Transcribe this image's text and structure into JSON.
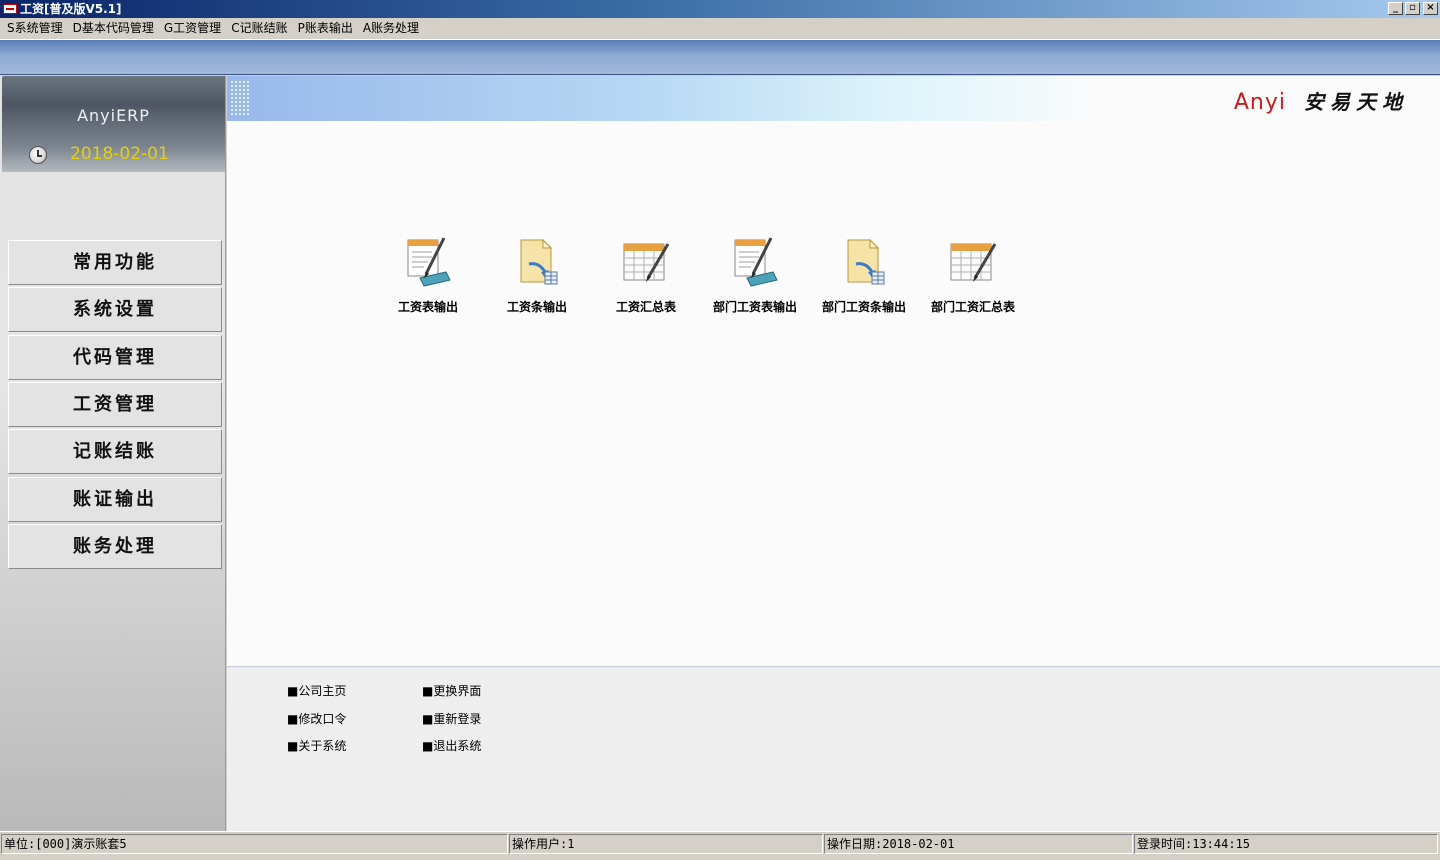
{
  "window": {
    "title": "工资[普及版V5.1]",
    "minimize_symbol": "_",
    "maximize_symbol": "▫",
    "close_symbol": "×"
  },
  "menubar": {
    "items": [
      "S系统管理",
      "D基本代码管理",
      "G工资管理",
      "C记账结账",
      "P账表输出",
      "A账务处理"
    ]
  },
  "sidebar": {
    "brand": "AnyiERP",
    "date": "2018-02-01",
    "nav": [
      "常用功能",
      "系统设置",
      "代码管理",
      "工资管理",
      "记账结账",
      "账证输出",
      "账务处理"
    ]
  },
  "header": {
    "logo_en": "Anyi",
    "logo_cn": "安易天地"
  },
  "functions": [
    {
      "label": "工资表输出",
      "icon": "report-pen-icon"
    },
    {
      "label": "工资条输出",
      "icon": "document-arrow-icon"
    },
    {
      "label": "工资汇总表",
      "icon": "spreadsheet-pen-icon"
    },
    {
      "label": "部门工资表输出",
      "icon": "report-pen-icon"
    },
    {
      "label": "部门工资条输出",
      "icon": "document-arrow-icon"
    },
    {
      "label": "部门工资汇总表",
      "icon": "spreadsheet-pen-icon"
    }
  ],
  "links": {
    "col1": [
      "■公司主页",
      "■修改口令",
      "■关于系统"
    ],
    "col2": [
      "■更换界面",
      "■重新登录",
      "■退出系统"
    ]
  },
  "statusbar": {
    "unit": "单位:[000]演示账套5",
    "user": "操作用户:1",
    "op_date": "操作日期:2018-02-01",
    "login_time": "登录时间:13:44:15"
  }
}
